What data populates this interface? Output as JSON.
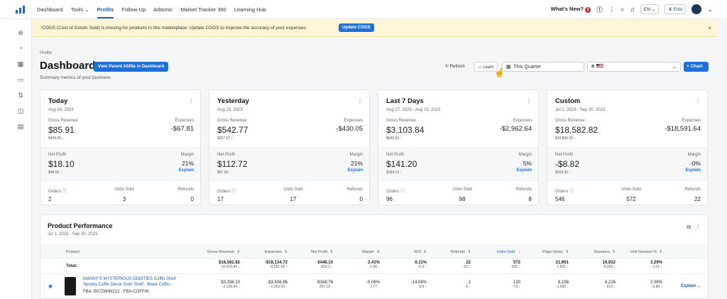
{
  "nav": {
    "items": [
      "Dashboard",
      "Tools",
      "Profits",
      "Follow-Up",
      "Adtomic",
      "Market Tracker 360",
      "Learning Hub"
    ],
    "active": "Profits",
    "whats_new": "What's New?",
    "whats_new_count": "2",
    "language": "EN",
    "plan": "Elite"
  },
  "banner": {
    "text": "COGS (Cost of Goods Sold) is missing for products in this marketplace. Update COGS to improve the accuracy of your expenses.",
    "button": "Update COGS",
    "close": "×"
  },
  "header": {
    "breadcrumb": "Profits",
    "title": "Dashboard",
    "parent_button": "View Parent ASINs in Dashboard",
    "subtitle": "Summary metrics of your business",
    "refresh": "Refresh",
    "learn": "Learn",
    "period": "This Quarter",
    "marketplace": "a",
    "chart_button": "+ Chart"
  },
  "cards": [
    {
      "name": "Today",
      "date": "Aug 24, 2023",
      "gross_label": "Gross Revenue",
      "gross": "$85.91",
      "gross_sub": "$456.06",
      "gross_dir": "down",
      "exp_label": "Expenses",
      "exp": "-$67.81",
      "np_label": "Net Profit",
      "np": "$18.10",
      "np_sub": "$94.62",
      "np_dir": "down",
      "margin_label": "Margin",
      "margin": "21%",
      "explain": "Explain",
      "orders_label": "Orders",
      "orders": "2",
      "units_label": "Units Sold",
      "units": "3",
      "refunds_label": "Refunds",
      "refunds": "0"
    },
    {
      "name": "Yesterday",
      "date": "Aug 23, 2023",
      "gross_label": "Gross Revenue",
      "gross": "$542.77",
      "gross_sub": "$257.07",
      "gross_dir": "up",
      "exp_label": "Expenses",
      "exp": "-$430.05",
      "np_label": "Net Profit",
      "np": "$112.72",
      "np_sub": "$87.00",
      "np_dir": "up",
      "margin_label": "Margin",
      "margin": "21%",
      "explain": "Explain",
      "orders_label": "Orders",
      "orders": "17",
      "units_label": "Units Sold",
      "units": "17",
      "refunds_label": "Refunds",
      "refunds": "0"
    },
    {
      "name": "Last 7 Days",
      "date": "Aug 17, 2023 - Aug 23, 2023",
      "gross_label": "Gross Revenue",
      "gross": "$3,103.84",
      "gross_sub": "$646.56",
      "gross_dir": "up",
      "exp_label": "Expenses",
      "exp": "-$2,962.64",
      "np_label": "Net Profit",
      "np": "$141.20",
      "np_sub": "$184.13",
      "np_dir": "up",
      "margin_label": "Margin",
      "margin": "5%",
      "explain": "Explain",
      "orders_label": "Orders",
      "orders": "96",
      "units_label": "Units Sold",
      "units": "98",
      "refunds_label": "Refunds",
      "refunds": "8"
    },
    {
      "name": "Custom",
      "date": "Jul 1, 2023 - Sep 30, 2023",
      "gross_label": "Gross Revenue",
      "gross": "$18,582.82",
      "gross_sub": "$10,866.50",
      "gross_dir": "down",
      "exp_label": "Expenses",
      "exp": "-$18,591.64",
      "np_label": "Net Profit",
      "np": "-$8.82",
      "np_sub": "$918.35",
      "np_dir": "down",
      "margin_label": "Margin",
      "margin": "-0%",
      "explain": "Explain",
      "orders_label": "Orders",
      "orders": "546",
      "units_label": "Units Sold",
      "units": "572",
      "refunds_label": "Refunds",
      "refunds": "22"
    }
  ],
  "performance": {
    "title": "Product Performance",
    "date": "Jul 1, 2023 - Sep 30, 2023",
    "columns": [
      "Product",
      "Gross Revenue",
      "Expenses",
      "Net Profit",
      "Margin",
      "ROI",
      "Refunds",
      "Units Sold",
      "Page Views",
      "Sessions",
      "Unit Session %"
    ],
    "total_label": "Total:",
    "total": [
      {
        "v": "$18,582.82",
        "s": "-10,410.89",
        "dir": "down"
      },
      {
        "v": "-$18,134.72",
        "s": "-9,591.65",
        "dir": "up"
      },
      {
        "v": "$448.10",
        "s": "-818.2",
        "dir": "down"
      },
      {
        "v": "2.41%",
        "s": "-1.96",
        "dir": "down"
      },
      {
        "v": "6.11%",
        "s": "-5.3",
        "dir": "down"
      },
      {
        "v": "22",
        "s": "-22",
        "dir": "down"
      },
      {
        "v": "572",
        "s": "-326",
        "dir": "down"
      },
      {
        "v": "21,901",
        "s": "-7,601",
        "dir": "down"
      },
      {
        "v": "16,922",
        "s": "-4,259",
        "dir": "down"
      },
      {
        "v": "3.29%",
        "s": "-1.01",
        "dir": "down"
      }
    ],
    "product": {
      "name": "MANNY'S MYSTERIOUS ODDITIES Coffin Shelf Spooky Coffin Decor Goth Shelf - Black Coffin...",
      "meta": "FBA: B07Z8HN212  ·  FBA-COFFIN",
      "values": [
        {
          "v": "$3,338.10",
          "s": "-2,105.84",
          "dir": "down"
        },
        {
          "v": "-$3,506.86",
          "s": "-2,363.03",
          "dir": "up"
        },
        {
          "v": "-$168.76",
          "s": "257.19",
          "dir": "up"
        },
        {
          "v": "-5.06%",
          "s": "2.77",
          "dir": "up"
        },
        {
          "v": "-14.08%",
          "s": "8.8",
          "dir": "up"
        },
        {
          "v": "2",
          "s": "-6",
          "dir": "down"
        },
        {
          "v": "130",
          "s": "-73",
          "dir": "down"
        },
        {
          "v": "8,158",
          "s": "-1,590",
          "dir": "down"
        },
        {
          "v": "6,226",
          "s": "-613",
          "dir": "down"
        },
        {
          "v": "2.09%",
          "s": "-0.86",
          "dir": "down"
        }
      ],
      "explain": "Explain"
    }
  }
}
